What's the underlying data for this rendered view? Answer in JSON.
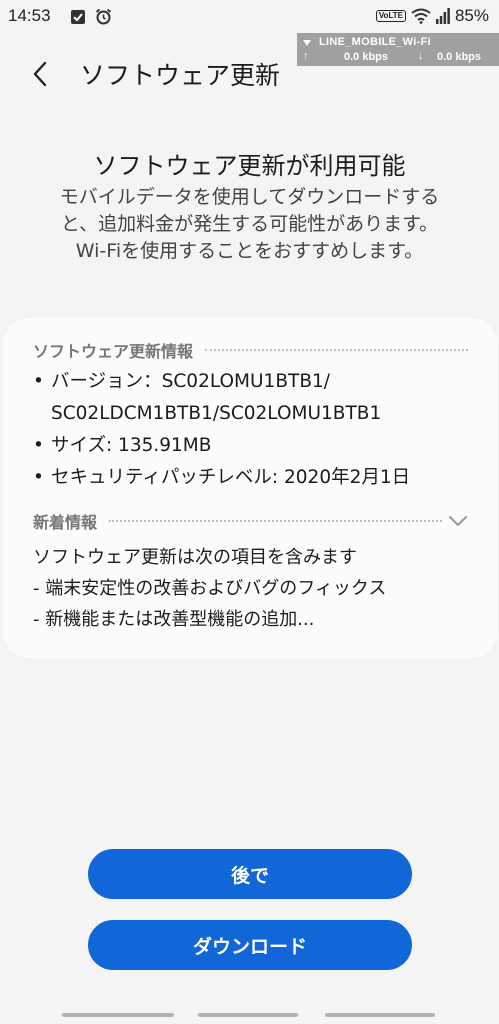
{
  "status_bar": {
    "time": "14:53",
    "volte": "VoLTE",
    "battery": "85%"
  },
  "network_overlay": {
    "name": "LINE_MOBILE_Wi-Fi",
    "up_speed": "0.0 kbps",
    "down_speed": "0.0 kbps"
  },
  "header": {
    "title": "ソフトウェア更新"
  },
  "hero": {
    "title": "ソフトウェア更新が利用可能",
    "description_lines": [
      "モバイルデータを使用してダウンロードする",
      "と、追加料金が発生する可能性があります。",
      "Wi-Fiを使用することをおすすめします。"
    ]
  },
  "info_card": {
    "section_title": "ソフトウェア更新情報",
    "version_label": "バージョン：",
    "version_line1": "SC02LOMU1BTB1/",
    "version_line2": "SC02LDCM1BTB1/SC02LOMU1BTB1",
    "size": "サイズ: 135.91MB",
    "security_patch": "セキュリティパッチレベル: 2020年2月1日",
    "whats_new_title": "新着情報",
    "whats_new_lines": [
      "ソフトウェア更新は次の項目を含みます",
      " - 端末安定性の改善およびバグのフィックス",
      " - 新機能または改善型機能の追加..."
    ]
  },
  "buttons": {
    "later": "後で",
    "download": "ダウンロード"
  },
  "colors": {
    "accent": "#1166d8",
    "background": "#f4f4f4",
    "card": "#fcfcfc"
  },
  "icons": [
    "back-icon",
    "check-notification-icon",
    "alarm-icon",
    "wifi-icon",
    "signal-icon",
    "chevron-down-icon"
  ]
}
